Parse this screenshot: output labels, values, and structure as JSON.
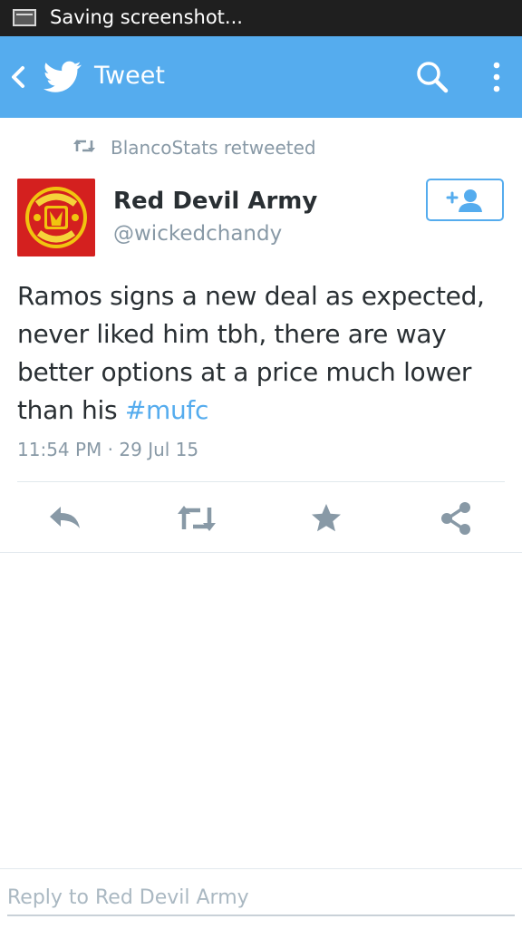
{
  "status_bar": {
    "text": "Saving screenshot..."
  },
  "action_bar": {
    "title": "Tweet",
    "icons": [
      "back-icon",
      "twitter-bird-icon",
      "search-icon",
      "overflow-menu-icon"
    ]
  },
  "retweet_context": {
    "text": "BlancoStats retweeted",
    "icon": "retweet-icon"
  },
  "tweet": {
    "author_name": "Red Devil Army",
    "author_handle": "@wickedchandy",
    "text": "Ramos signs a new deal as expected, never liked him tbh, there are way better options at a price much lower than his ",
    "hashtag": "#mufc",
    "timestamp": "11:54 PM · 29 Jul 15"
  },
  "actions": [
    "reply-icon",
    "retweet-icon",
    "favorite-star-icon",
    "share-icon"
  ],
  "reply": {
    "placeholder": "Reply to Red Devil Army"
  },
  "colors": {
    "twitter_blue": "#55acee",
    "status_bar": "#1f1f1f",
    "text_primary": "#292f33",
    "text_secondary": "#8899a6",
    "action_icons": "#8899a6",
    "avatar_red": "#d4201f"
  }
}
